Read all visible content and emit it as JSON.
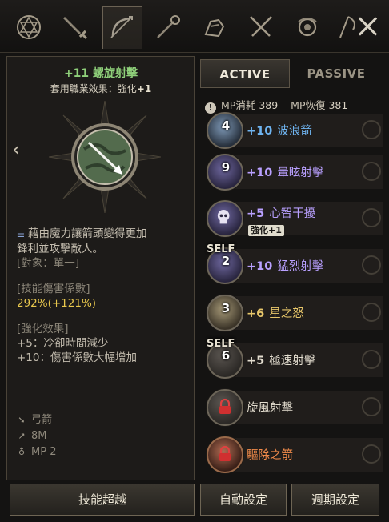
{
  "top_tabs": [
    {
      "icon": "hexagram-icon"
    },
    {
      "icon": "greatsword-icon"
    },
    {
      "icon": "bow-icon"
    },
    {
      "icon": "staff-icon"
    },
    {
      "icon": "gauntlet-icon"
    },
    {
      "icon": "crossed-swords-icon"
    },
    {
      "icon": "orb-icon"
    },
    {
      "icon": "scythe-icon"
    }
  ],
  "left": {
    "title": "+11 螺旋射擊",
    "subtitle_label": "套用職業效果：強化",
    "subtitle_value": "+1",
    "description": [
      "藉由魔力讓箭頭變得更加",
      "鋒利並攻擊敵人。"
    ],
    "target": "[對象：單一]",
    "coef_label": "[技能傷害係數]",
    "coef_value": "292%(+121%)",
    "enh_label": "[強化效果]",
    "enh_lines": [
      "+5：冷卻時間減少",
      "+10：傷害係數大幅增加"
    ],
    "weapon": "弓箭",
    "range": "8M",
    "mp": "MP 2"
  },
  "tabs": {
    "active": "ACTIVE",
    "passive": "PASSIVE"
  },
  "mp": {
    "cost_label": "MP消耗",
    "cost_value": "389",
    "regen_label": "MP恢復",
    "regen_value": "381"
  },
  "skills": [
    {
      "level": "4",
      "enh": "+10",
      "name": "波浪箭",
      "color": "#6fb4f0",
      "self": ""
    },
    {
      "level": "9",
      "enh": "+10",
      "name": "暈眩射擊",
      "color": "#b9a0ff",
      "self": ""
    },
    {
      "level": "",
      "enh": "+5",
      "name": "心智干擾",
      "color": "#b9a0ff",
      "self": "",
      "badge": "強化+1"
    },
    {
      "level": "2",
      "enh": "+10",
      "name": "猛烈射擊",
      "color": "#b9a0ff",
      "self": "SELF"
    },
    {
      "level": "3",
      "enh": "+6",
      "name": "星之怒",
      "color": "#e8c76a",
      "self": ""
    },
    {
      "level": "6",
      "enh": "+5",
      "name": "極速射擊",
      "color": "#e3ddcf",
      "self": "SELF"
    },
    {
      "level": "",
      "enh": "",
      "name": "旋風射擊",
      "color": "#e3ddcf",
      "self": "",
      "locked": true
    },
    {
      "level": "",
      "enh": "",
      "name": "驅除之箭",
      "color": "#f08a4a",
      "self": "",
      "locked": true
    }
  ],
  "buttons": {
    "transcend": "技能超越",
    "auto": "自動設定",
    "cycle": "週期設定"
  }
}
